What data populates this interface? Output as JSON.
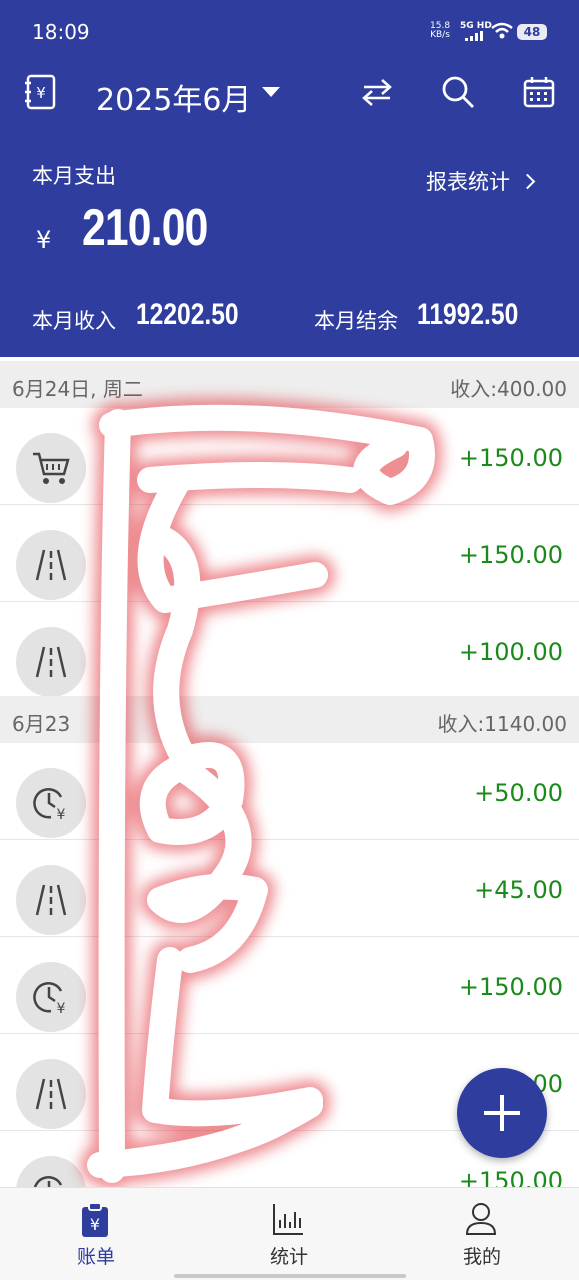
{
  "status_bar": {
    "time": "18:09",
    "net_speed_value": "15.8",
    "net_speed_unit": "KB/s",
    "network": "5G HD",
    "battery": "48"
  },
  "toolbar": {
    "month": "2025年6月",
    "icons": [
      "ledger-book-icon",
      "swap-icon",
      "search-icon",
      "calendar-icon"
    ]
  },
  "summary": {
    "expense_label": "本月支出",
    "currency": "¥",
    "expense_amount": "210.00",
    "report_link": "报表统计",
    "income_label": "本月收入",
    "income_value": "12202.50",
    "balance_label": "本月结余",
    "balance_value": "11992.50"
  },
  "days": [
    {
      "date": "6月24日, 周二",
      "summary": "收入:400.00",
      "rows": [
        {
          "icon": "cart-icon",
          "amount": "+150.00"
        },
        {
          "icon": "road-icon",
          "amount": "+150.00"
        },
        {
          "icon": "road-icon",
          "amount": "+100.00"
        }
      ]
    },
    {
      "date": "6月23",
      "summary": "收入:1140.00",
      "rows": [
        {
          "icon": "clock-yen-icon",
          "amount": "+50.00"
        },
        {
          "icon": "road-icon",
          "amount": "+45.00"
        },
        {
          "icon": "clock-yen-icon",
          "amount": "+150.00"
        },
        {
          "icon": "road-icon",
          "amount": "00"
        },
        {
          "icon": "clock-yen-icon",
          "amount": "+150.00"
        }
      ]
    }
  ],
  "bottom_nav": [
    {
      "label": "账单",
      "icon": "bill-icon",
      "active": true
    },
    {
      "label": "统计",
      "icon": "chart-icon",
      "active": false
    },
    {
      "label": "我的",
      "icon": "person-icon",
      "active": false
    }
  ],
  "fab_icon": "plus-icon",
  "colors": {
    "primary": "#2f3d9e",
    "income_green": "#1a8a1a",
    "scribble_red": "#e0303a"
  }
}
